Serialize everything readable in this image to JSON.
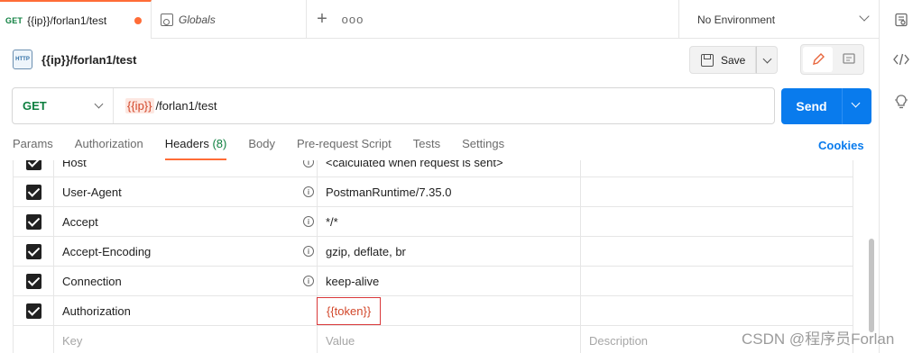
{
  "tabs": {
    "active": {
      "method": "GET",
      "title": "{{ip}}/forlan1/test"
    },
    "globals": {
      "title": "Globals"
    },
    "new_tab_label": "+",
    "more_label": "ooo"
  },
  "environment": {
    "selected": "No Environment"
  },
  "request": {
    "name": "{{ip}}/forlan1/test",
    "http_badge": "HTTP",
    "save_label": "Save",
    "method": "GET",
    "url_var": "{{ip}}",
    "url_path": "/forlan1/test",
    "send_label": "Send"
  },
  "subtabs": {
    "params": "Params",
    "authorization": "Authorization",
    "headers": "Headers",
    "headers_count": "(8)",
    "body": "Body",
    "prerequest": "Pre-request Script",
    "tests": "Tests",
    "settings": "Settings",
    "cookies": "Cookies"
  },
  "headers_table": {
    "rows": [
      {
        "key": "Host",
        "value": "<calculated when request is sent>"
      },
      {
        "key": "User-Agent",
        "value": "PostmanRuntime/7.35.0"
      },
      {
        "key": "Accept",
        "value": "*/*"
      },
      {
        "key": "Accept-Encoding",
        "value": "gzip, deflate, br"
      },
      {
        "key": "Connection",
        "value": "keep-alive"
      },
      {
        "key": "Authorization",
        "value": "{{token}}"
      }
    ],
    "placeholder": {
      "key": "Key",
      "value": "Value",
      "description": "Description"
    },
    "info_glyph": "i"
  },
  "watermark": "CSDN @程序员Forlan",
  "colors": {
    "accent": "#ff6c37",
    "send": "#097bed",
    "method_get": "#0d7f3f",
    "var": "#d2472a"
  }
}
